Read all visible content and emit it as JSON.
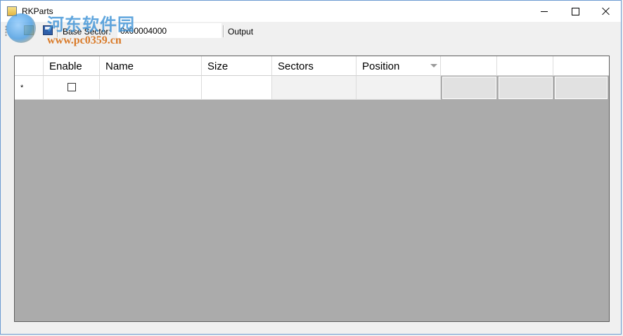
{
  "window": {
    "title": "RKParts",
    "controls": {
      "minimize": "minimize-icon",
      "maximize": "maximize-icon",
      "close": "close-icon"
    }
  },
  "toolbar": {
    "base_sector_label": "Base Sector:",
    "base_sector_value": "0x00004000",
    "output_label": "Output",
    "icons": [
      "open-icon",
      "save-icon"
    ]
  },
  "watermark": {
    "site_name": "河东软件园",
    "url": "www.pc0359.cn"
  },
  "grid": {
    "columns": [
      "Enable",
      "Name",
      "Size",
      "Sectors",
      "Position",
      "",
      "",
      ""
    ],
    "sorted_column": "Position",
    "new_row_glyph": "*",
    "rows": [
      {
        "enable": false,
        "name": "",
        "size": "",
        "sectors": "",
        "position": ""
      }
    ],
    "colors": {
      "background": "#ababab",
      "header": "#ffffff"
    }
  }
}
